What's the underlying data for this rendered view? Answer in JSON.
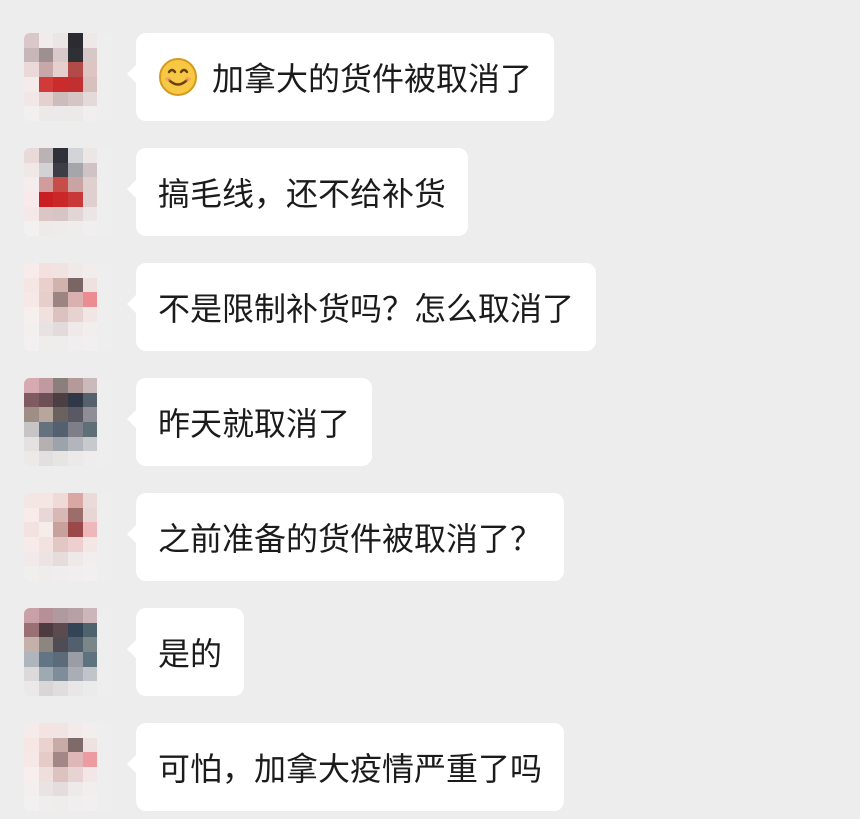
{
  "messages": [
    {
      "text": "加拿大的货件被取消了",
      "emoji": "smile-emoji"
    },
    {
      "text": "搞毛线，还不给补货"
    },
    {
      "text": "不是限制补货吗？怎么取消了"
    },
    {
      "text": "昨天就取消了"
    },
    {
      "text": "之前准备的货件被取消了？"
    },
    {
      "text": "是的"
    },
    {
      "text": "可怕，加拿大疫情严重了吗"
    }
  ],
  "colors": {
    "background": "#ededed",
    "bubble": "#ffffff",
    "text": "#1b1b1b"
  }
}
